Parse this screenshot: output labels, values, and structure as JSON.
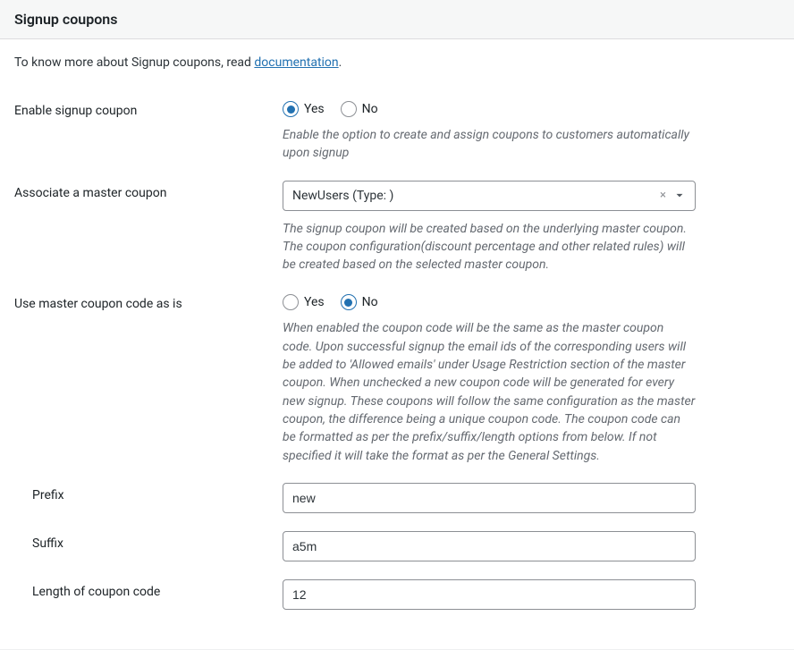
{
  "header": {
    "title": "Signup coupons"
  },
  "intro": {
    "prefix": "To know more about Signup coupons, read ",
    "link": "documentation",
    "suffix": "."
  },
  "fields": {
    "enable": {
      "label": "Enable signup coupon",
      "yes": "Yes",
      "no": "No",
      "desc": "Enable the option to create and assign coupons to customers automatically upon signup"
    },
    "associate": {
      "label": "Associate a master coupon",
      "value": "NewUsers (Type: )",
      "desc": "The signup coupon will be created based on the underlying master coupon. The coupon configuration(discount percentage and other related rules) will be created based on the selected master coupon."
    },
    "useMaster": {
      "label": "Use master coupon code as is",
      "yes": "Yes",
      "no": "No",
      "desc": "When enabled the coupon code will be the same as the master coupon code. Upon successful signup the email ids of the corresponding users will be added to 'Allowed emails' under Usage Restriction section of the master coupon. When unchecked a new coupon code will be generated for every new signup. These coupons will follow the same configuration as the master coupon, the difference being a unique coupon code. The coupon code can be formatted as per the prefix/suffix/length options from below. If not specified it will take the format as per the General Settings."
    },
    "prefix": {
      "label": "Prefix",
      "value": "new"
    },
    "suffix": {
      "label": "Suffix",
      "value": "a5m"
    },
    "length": {
      "label": "Length of coupon code",
      "value": "12"
    }
  }
}
